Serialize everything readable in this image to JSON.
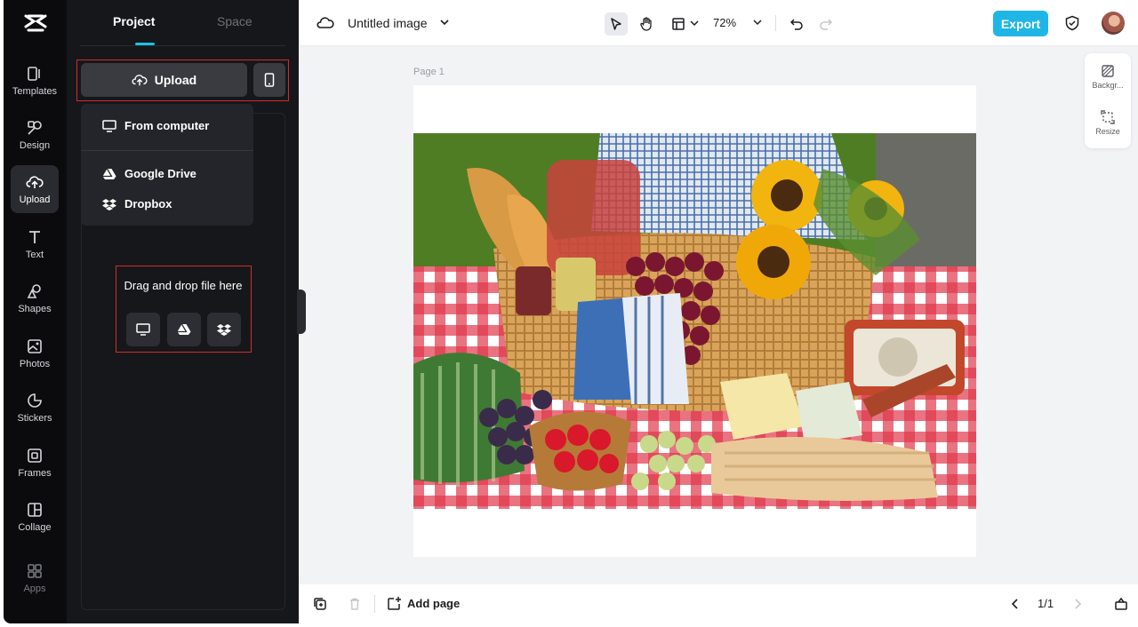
{
  "rail": {
    "items": [
      {
        "label": "Templates",
        "icon": "templates-icon"
      },
      {
        "label": "Design",
        "icon": "design-icon"
      },
      {
        "label": "Upload",
        "icon": "upload-icon"
      },
      {
        "label": "Text",
        "icon": "text-icon"
      },
      {
        "label": "Shapes",
        "icon": "shapes-icon"
      },
      {
        "label": "Photos",
        "icon": "photos-icon"
      },
      {
        "label": "Stickers",
        "icon": "stickers-icon"
      },
      {
        "label": "Frames",
        "icon": "frames-icon"
      },
      {
        "label": "Collage",
        "icon": "collage-icon"
      },
      {
        "label": "Apps",
        "icon": "apps-icon"
      }
    ],
    "active": "Upload"
  },
  "panel": {
    "tabs": [
      {
        "label": "Project"
      },
      {
        "label": "Space"
      }
    ],
    "upload_label": "Upload",
    "menu": [
      {
        "label": "From computer",
        "icon": "monitor-icon"
      },
      {
        "label": "Google Drive",
        "icon": "google-drive-icon"
      },
      {
        "label": "Dropbox",
        "icon": "dropbox-icon"
      }
    ],
    "drop_text": "Drag and drop file here"
  },
  "topbar": {
    "title": "Untitled image",
    "zoom": "72%",
    "export_label": "Export"
  },
  "canvas": {
    "page_label": "Page 1"
  },
  "side_tools": [
    {
      "label": "Backgr...",
      "icon": "background-icon"
    },
    {
      "label": "Resize",
      "icon": "resize-icon"
    }
  ],
  "bottombar": {
    "add_page_label": "Add page",
    "page_counter": "1/1"
  },
  "colors": {
    "accent": "#1fb6e6",
    "highlight": "#d32b2b",
    "rail_bg": "#0b0b0d",
    "panel_bg": "#16171a"
  }
}
